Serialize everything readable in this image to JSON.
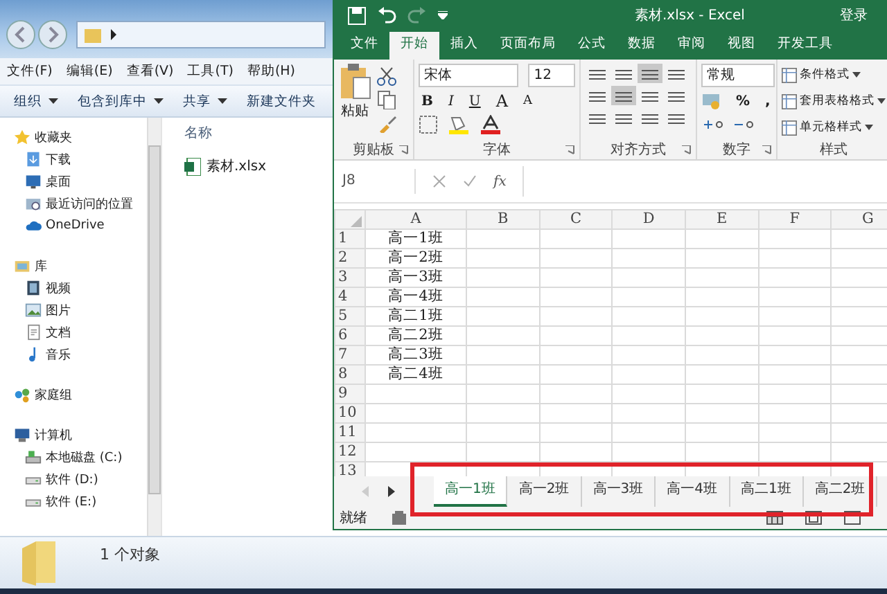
{
  "explorer": {
    "menu": [
      "文件(F)",
      "编辑(E)",
      "查看(V)",
      "工具(T)",
      "帮助(H)"
    ],
    "toolbar": [
      {
        "label": "组织",
        "dropdown": true
      },
      {
        "label": "包含到库中",
        "dropdown": true
      },
      {
        "label": "共享",
        "dropdown": true
      },
      {
        "label": "新建文件夹",
        "dropdown": false
      }
    ],
    "nav": [
      {
        "label": "收藏夹",
        "kind": "star",
        "children": [
          {
            "label": "下载",
            "kind": "download"
          },
          {
            "label": "桌面",
            "kind": "desktop"
          },
          {
            "label": "最近访问的位置",
            "kind": "recent"
          },
          {
            "label": "OneDrive",
            "kind": "cloud"
          }
        ]
      },
      {
        "label": "库",
        "kind": "library",
        "children": [
          {
            "label": "视频",
            "kind": "video"
          },
          {
            "label": "图片",
            "kind": "image"
          },
          {
            "label": "文档",
            "kind": "doc"
          },
          {
            "label": "音乐",
            "kind": "music"
          }
        ]
      },
      {
        "label": "家庭组",
        "kind": "homegroup"
      },
      {
        "label": "计算机",
        "kind": "computer",
        "children": [
          {
            "label": "本地磁盘 (C:)",
            "kind": "sysdrive"
          },
          {
            "label": "软件 (D:)",
            "kind": "drive"
          },
          {
            "label": "软件 (E:)",
            "kind": "drive"
          }
        ]
      }
    ],
    "column": "名称",
    "files": [
      {
        "name": "素材.xlsx"
      }
    ],
    "status": "1 个对象"
  },
  "excel": {
    "title": "素材.xlsx  -  Excel",
    "signin": "登录",
    "tabs": [
      {
        "label": "文件",
        "selected": false
      },
      {
        "label": "开始",
        "selected": true
      },
      {
        "label": "插入",
        "selected": false
      },
      {
        "label": "页面布局",
        "selected": false
      },
      {
        "label": "公式",
        "selected": false
      },
      {
        "label": "数据",
        "selected": false
      },
      {
        "label": "审阅",
        "selected": false
      },
      {
        "label": "视图",
        "selected": false
      },
      {
        "label": "开发工具",
        "selected": false
      }
    ],
    "ribbon": {
      "paste": "粘贴",
      "font": "宋体",
      "size": "12",
      "font_buttons": [
        "B",
        "I",
        "U"
      ],
      "grow": "A",
      "shrink": "A",
      "number_format": "常规",
      "percent": "%",
      "comma": ",",
      "styles": [
        "条件格式",
        "套用表格格式",
        "单元格样式"
      ],
      "groups": [
        "剪贴板",
        "字体",
        "对齐方式",
        "数字",
        "样式"
      ]
    },
    "name_box": "J8",
    "fx": "fx",
    "columns": [
      "A",
      "B",
      "C",
      "D",
      "E",
      "F",
      "G"
    ],
    "rows": [
      {
        "n": "1",
        "a": "高一1班"
      },
      {
        "n": "2",
        "a": "高一2班"
      },
      {
        "n": "3",
        "a": "高一3班"
      },
      {
        "n": "4",
        "a": "高一4班"
      },
      {
        "n": "5",
        "a": "高二1班"
      },
      {
        "n": "6",
        "a": "高二2班"
      },
      {
        "n": "7",
        "a": "高二3班"
      },
      {
        "n": "8",
        "a": "高二4班"
      },
      {
        "n": "9"
      },
      {
        "n": "10"
      },
      {
        "n": "11"
      },
      {
        "n": "12"
      },
      {
        "n": "13"
      }
    ],
    "sheets": [
      {
        "label": "高一1班",
        "selected": true
      },
      {
        "label": "高一2班",
        "selected": false
      },
      {
        "label": "高一3班",
        "selected": false
      },
      {
        "label": "高一4班",
        "selected": false
      },
      {
        "label": "高二1班",
        "selected": false
      },
      {
        "label": "高二2班",
        "selected": false
      }
    ],
    "sheets_highlighted": true,
    "status": "就绪"
  }
}
